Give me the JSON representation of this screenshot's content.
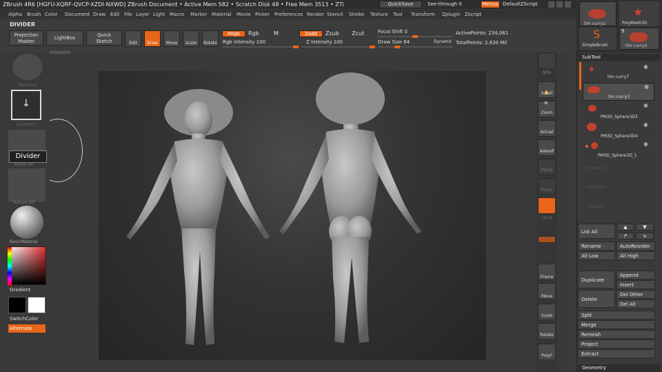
{
  "title_bar": {
    "text": "ZBrush 4R6 [HGFU-XQRF-QVCP-XZDI-NXWD]   ZBrush Document   • Active Mem 582 • Scratch Disk 48 • Free Mem 3513 • ZTi",
    "quicksave": "QuickSave",
    "seethrough": "See-through  0",
    "menus": "Menus",
    "defaultzscript": "DefaultZScript"
  },
  "menu": [
    "Alpha",
    "Brush",
    "Color",
    "Document",
    "Draw",
    "Edit",
    "File",
    "Layer",
    "Light",
    "Macro",
    "Marker",
    "Material",
    "Movie",
    "Picker",
    "Preferences",
    "Render",
    "Stencil",
    "Stroke",
    "Texture",
    "Tool",
    "Transform",
    "Zplugin",
    "Zscript"
  ],
  "toolbar": {
    "divider": "DIVIDER",
    "projection": "Projection",
    "master": "Master",
    "lightbox": "LightBox",
    "quick": "Quick",
    "sketch": "Sketch",
    "edit": "Edit",
    "draw": "Draw",
    "move": "Move",
    "scale": "Scale",
    "rotate": "Rotate",
    "mrgb": "Mrgb",
    "rgb": "Rgb",
    "m": "M",
    "rgb_intensity": "Rgb Intensity 100",
    "zadd": "Zadd",
    "zsub": "Zsub",
    "zcut": "Zcut",
    "z_intensity": "Z Intensity 100",
    "focal_shift": "Focal Shift 0",
    "draw_size": "Draw Size 64",
    "dynamic": "Dynamic",
    "active_points": "ActivePoints: 234,061",
    "total_points": "TotalPoints: 2.830 Mil"
  },
  "left": {
    "standard": "Standard",
    "dragrect": "DragRect",
    "alpha_off": "Alpha Off",
    "divider_tip": "Divider",
    "texture_off": "Texture Off",
    "basic_material": "BasicMaterial",
    "gradient": "Gradient",
    "switchcolor": "SwitchColor",
    "alternate": "Alternate"
  },
  "right_shelf": {
    "spix": "SPix",
    "scroll": "Scroll",
    "zoom": "Zoom",
    "actual": "Actual",
    "aahalf": "AAHalf",
    "persp": "Persp",
    "floor": "Floor",
    "local": "Local",
    "frame": "Frame",
    "move": "Move",
    "scale": "Scale",
    "rotate": "Rotate",
    "polyf": "PolyF"
  },
  "tool_thumbs": {
    "tim_curry2": "tim curry2",
    "polymesh3d": "PolyMesh3D",
    "simplebrush": "SimpleBrush",
    "tim_curry3": "tim curry3",
    "count": "5"
  },
  "subtool": {
    "header": "SubTool",
    "items": [
      "tim curry7",
      "tim curry3",
      "PM3D_Sphere3D3",
      "PM3D_Sphere3D4",
      "PM3D_Sphere3D_1",
      "Unused 5",
      "Unused 6",
      "Unused 7"
    ],
    "list_all": "List All",
    "rename": "Rename",
    "autoreorder": "AutoReorder",
    "all_low": "All Low",
    "all_high": "All High",
    "duplicate": "Duplicate",
    "append": "Append",
    "insert": "Insert",
    "delete": "Delete",
    "del_other": "Del Other",
    "del_all": "Del All",
    "split": "Split",
    "merge": "Merge",
    "remesh": "Remesh",
    "project": "Project",
    "extract": "Extract",
    "geometry": "Geometry"
  }
}
